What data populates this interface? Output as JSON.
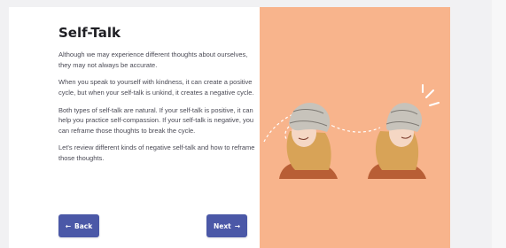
{
  "title": "Self-Talk",
  "paragraphs": [
    "Although we may experience different thoughts about ourselves, they may not always be accurate.",
    "When you speak to yourself with kindness, it can create a positive cycle, but when your self-talk is unkind, it creates a negative cycle.",
    "Both types of self-talk are natural. If your self-talk is positive, it can help you practice self-compassion. If your self-talk is negative, you can reframe those thoughts to break the cycle.",
    "Let's review different kinds of negative self-talk and how to reframe those thoughts."
  ],
  "buttons": {
    "back_label": "Back",
    "next_label": "Next",
    "back_icon": "←",
    "next_icon": "→"
  },
  "colors": {
    "panel": "#f8b48c",
    "button": "#4b58a7"
  },
  "icons": {
    "back": "arrow-left-icon",
    "next": "arrow-right-icon"
  }
}
